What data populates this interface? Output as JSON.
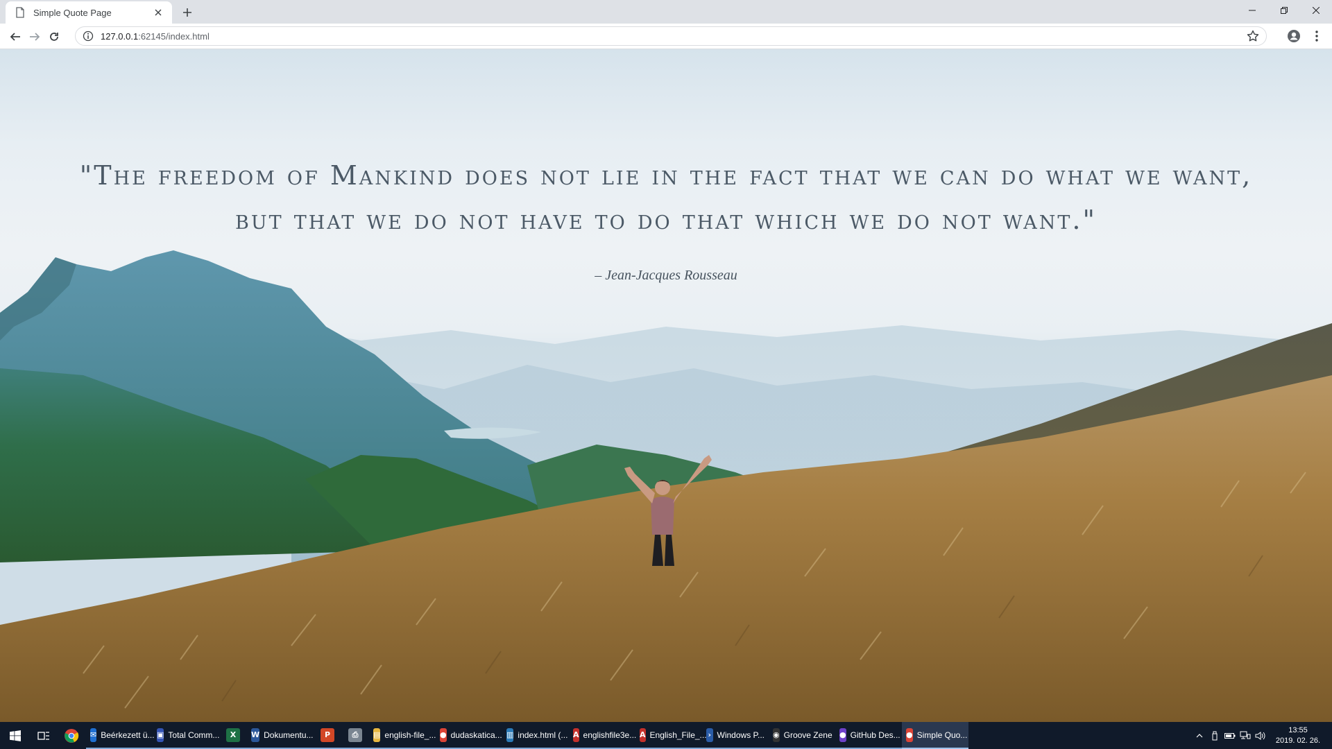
{
  "browser": {
    "tab_title": "Simple Quote Page",
    "url_host": "127.0.0.1",
    "url_path": ":62145/index.html"
  },
  "page": {
    "quote_line1": "\"The freedom of Mankind does not lie in the fact that we can do what we want,",
    "quote_line2": "but that we do not have to do that which we do not want.\"",
    "author": "– Jean-Jacques Rousseau"
  },
  "taskbar": {
    "apps": [
      {
        "label": "Beérkezett ü...",
        "icon": "mail-icon",
        "color": "#1f6fd1",
        "state": "open"
      },
      {
        "label": "Total Comm...",
        "icon": "floppy-icon",
        "color": "#3454b4",
        "state": "open"
      },
      {
        "label": "",
        "icon": "excel-icon",
        "color": "#1e7145",
        "state": "open"
      },
      {
        "label": "Dokumentu...",
        "icon": "word-icon",
        "color": "#2b579a",
        "state": "open"
      },
      {
        "label": "",
        "icon": "powerpoint-icon",
        "color": "#d24726",
        "state": "open"
      },
      {
        "label": "",
        "icon": "scanner-icon",
        "color": "#7a8591",
        "state": "open"
      },
      {
        "label": "english-file_...",
        "icon": "folder-icon",
        "color": "#e6b640",
        "state": "open"
      },
      {
        "label": "dudaskatica...",
        "icon": "chrome-icon",
        "color": "#db4437",
        "state": "open"
      },
      {
        "label": "index.html (...",
        "icon": "editor-icon",
        "color": "#2a7ab8",
        "state": "open"
      },
      {
        "label": "englishfile3e...",
        "icon": "pdf-icon",
        "color": "#c4302b",
        "state": "open"
      },
      {
        "label": "English_File_...",
        "icon": "pdf-icon",
        "color": "#c4302b",
        "state": "open"
      },
      {
        "label": "Windows P...",
        "icon": "powershell-icon",
        "color": "#2a5ca8",
        "state": "open"
      },
      {
        "label": "Groove Zene",
        "icon": "groove-icon",
        "color": "#333333",
        "state": "open"
      },
      {
        "label": "GitHub Des...",
        "icon": "github-icon",
        "color": "#6e40c9",
        "state": "open"
      },
      {
        "label": "Simple Quo...",
        "icon": "chrome-icon",
        "color": "#db4437",
        "state": "active"
      }
    ],
    "clock_time": "13:55",
    "clock_date": "2019. 02. 26."
  }
}
